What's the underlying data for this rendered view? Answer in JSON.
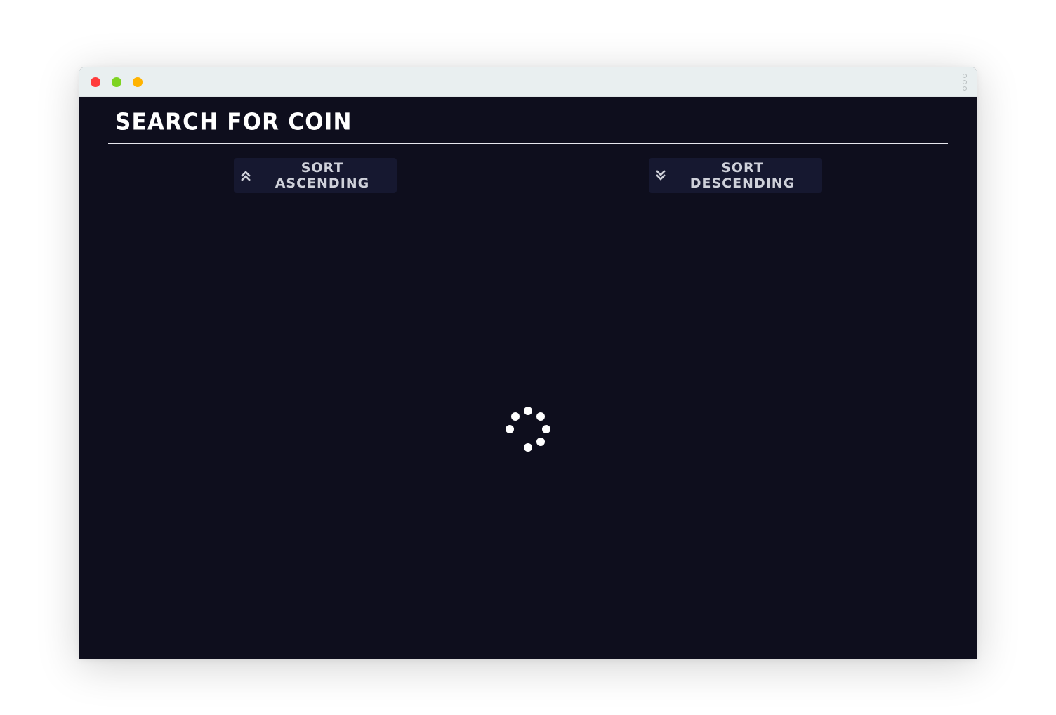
{
  "window": {
    "controls": {
      "close_color": "#ff3b3b",
      "minimize_color": "#7ed321",
      "maximize_color": "#ffb300"
    },
    "menu_icon": "vertical-dots-icon"
  },
  "page": {
    "title": "Search for coin"
  },
  "sort": {
    "ascending_label": "Sort Ascending",
    "ascending_icon": "double-chevron-up-icon",
    "descending_label": "Sort Descending",
    "descending_icon": "double-chevron-down-icon"
  },
  "loading": {
    "icon": "loading-spinner-icon"
  },
  "colors": {
    "background": "#0e0e1d",
    "button_background": "#161830",
    "button_text": "#cfd1da",
    "titlebar": "#e9eff0"
  }
}
